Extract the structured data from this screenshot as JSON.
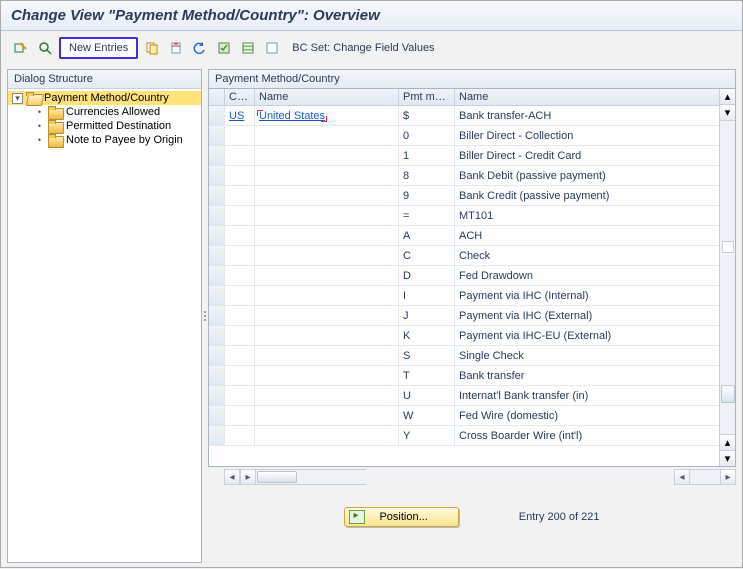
{
  "title": "Change View \"Payment Method/Country\": Overview",
  "toolbar": {
    "new_entries": "New Entries",
    "bc_set": "BC Set: Change Field Values"
  },
  "tree": {
    "title": "Dialog Structure",
    "root": {
      "label": "Payment Method/Country"
    },
    "children": [
      {
        "label": "Currencies Allowed"
      },
      {
        "label": "Permitted Destination"
      },
      {
        "label": "Note to Payee by Origin"
      }
    ]
  },
  "grid": {
    "title": "Payment Method/Country",
    "columns": {
      "co": "Co...",
      "name": "Name",
      "pm": "Pmt me...",
      "desc": "Name"
    },
    "first_row": {
      "country": "US",
      "country_name": "United States"
    },
    "rows": [
      {
        "pm": "$",
        "desc": "Bank transfer-ACH"
      },
      {
        "pm": "0",
        "desc": "Biller Direct - Collection"
      },
      {
        "pm": "1",
        "desc": "Biller Direct - Credit Card"
      },
      {
        "pm": "8",
        "desc": "Bank Debit (passive payment)"
      },
      {
        "pm": "9",
        "desc": "Bank Credit (passive payment)"
      },
      {
        "pm": "=",
        "desc": "MT101"
      },
      {
        "pm": "A",
        "desc": "ACH"
      },
      {
        "pm": "C",
        "desc": "Check"
      },
      {
        "pm": "D",
        "desc": "Fed Drawdown"
      },
      {
        "pm": "I",
        "desc": "Payment via IHC (Internal)"
      },
      {
        "pm": "J",
        "desc": "Payment via IHC (External)"
      },
      {
        "pm": "K",
        "desc": "Payment via IHC-EU (External)"
      },
      {
        "pm": "S",
        "desc": "Single Check"
      },
      {
        "pm": "T",
        "desc": "Bank transfer"
      },
      {
        "pm": "U",
        "desc": "Internat'l Bank transfer (in)"
      },
      {
        "pm": "W",
        "desc": "Fed Wire (domestic)"
      },
      {
        "pm": "Y",
        "desc": "Cross Boarder Wire (int'l)"
      }
    ]
  },
  "footer": {
    "position": "Position...",
    "entry": "Entry 200 of 221"
  }
}
